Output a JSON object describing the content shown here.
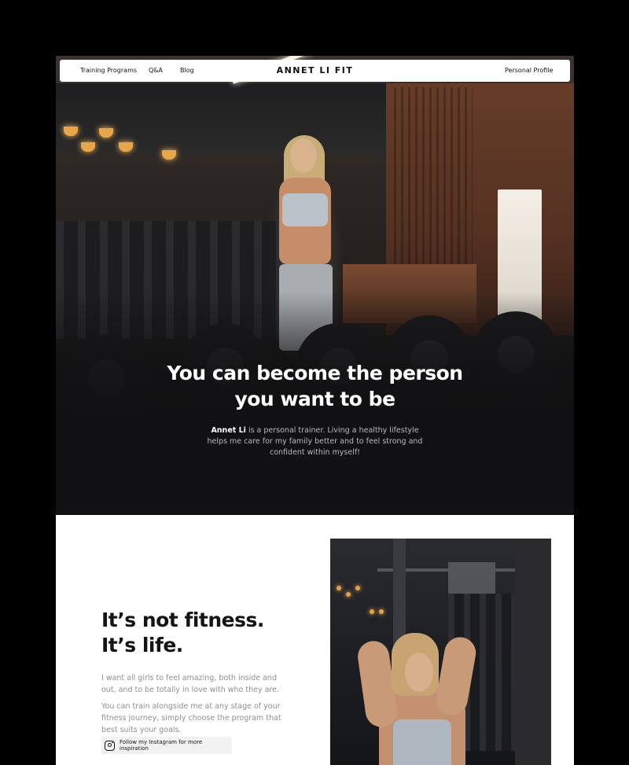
{
  "nav": {
    "links_left": [
      "Training Programs",
      "Q&A",
      "Blog"
    ],
    "brand": "ANNET LI FIT",
    "link_right": "Personal Profile"
  },
  "hero": {
    "title_line1": "You can become the person",
    "title_line2": "you want to be",
    "sub_name": "Annet Li",
    "sub_rest": " is a personal trainer. Living a healthy lifestyle helps me care for my family better and to feel strong and confident within myself!"
  },
  "about": {
    "title_line1": "It’s not fitness.",
    "title_line2": "It’s life.",
    "paragraph1": "I want all girls to feel amazing, both inside and out, and to be totally in love with who they are.",
    "paragraph2": "You can train alongside me at any stage of your fitness journey, simply choose the program that best suits your goals.",
    "instagram_button": "Follow my Instagram for more inspiration",
    "instagram_icon": "instagram-icon"
  },
  "colors": {
    "page_background": "#000000",
    "hero_background": "#111113",
    "text_dark": "#141414",
    "text_muted": "#8e8e93",
    "button_background": "#f2f2f3"
  }
}
